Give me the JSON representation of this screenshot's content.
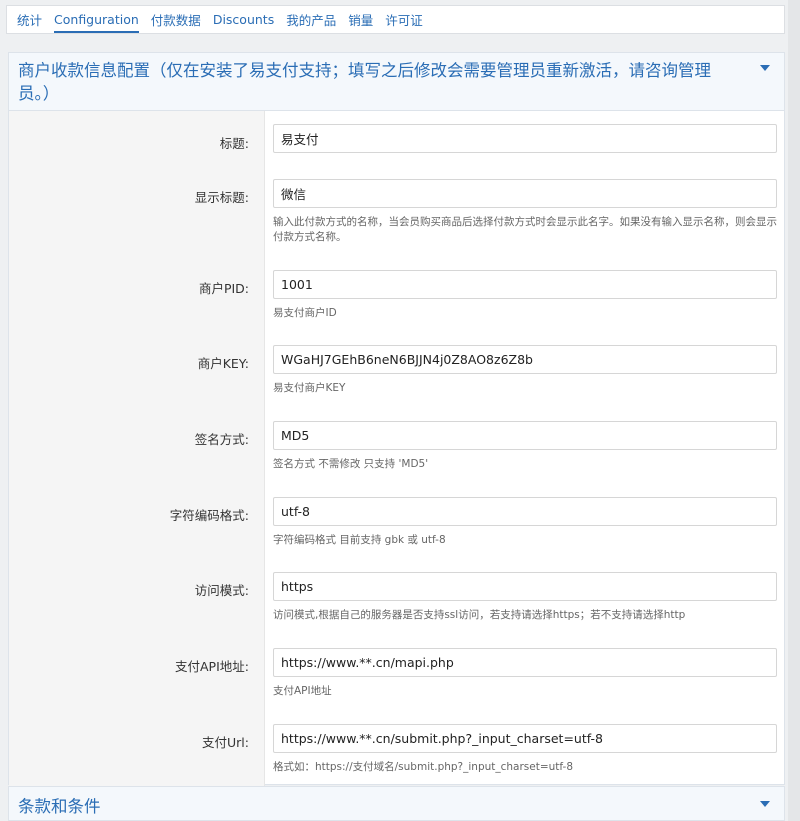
{
  "tabs": [
    {
      "label": "统计"
    },
    {
      "label": "Configuration"
    },
    {
      "label": "付款数据"
    },
    {
      "label": "Discounts"
    },
    {
      "label": "我的产品"
    },
    {
      "label": "销量"
    },
    {
      "label": "许可证"
    }
  ],
  "active_tab": "Configuration",
  "panel": {
    "title": "商户收款信息配置（仅在安装了易支付支持；填写之后修改会需要管理员重新激活，请咨询管理员。）"
  },
  "fields": [
    {
      "label": "标题:",
      "value": "易支付",
      "help": ""
    },
    {
      "label": "显示标题:",
      "value": "微信",
      "help": "输入此付款方式的名称，当会员购买商品后选择付款方式时会显示此名字。如果没有输入显示名称，则会显示付款方式名称。"
    },
    {
      "label": "商户PID:",
      "value": "1001",
      "help": "易支付商户ID"
    },
    {
      "label": "商户KEY:",
      "value": "WGaHJ7GEhB6neN6BJJN4j0Z8AO8z6Z8b",
      "help": "易支付商户KEY"
    },
    {
      "label": "签名方式:",
      "value": "MD5",
      "help": "签名方式 不需修改 只支持 'MD5'"
    },
    {
      "label": "字符编码格式:",
      "value": "utf-8",
      "help": "字符编码格式 目前支持 gbk 或 utf-8"
    },
    {
      "label": "访问模式:",
      "value": "https",
      "help": "访问模式,根据自己的服务器是否支持ssl访问，若支持请选择https；若不支持请选择http"
    },
    {
      "label": "支付API地址:",
      "value": "https://www.**.cn/mapi.php",
      "help": "支付API地址"
    },
    {
      "label": "支付Url:",
      "value": "https://www.**.cn/submit.php?_input_charset=utf-8",
      "help": "格式如：https://支付域名/submit.php?_input_charset=utf-8"
    }
  ],
  "panel2": {
    "title": "条款和条件"
  },
  "colors": {
    "accent": "#2a6db5"
  }
}
